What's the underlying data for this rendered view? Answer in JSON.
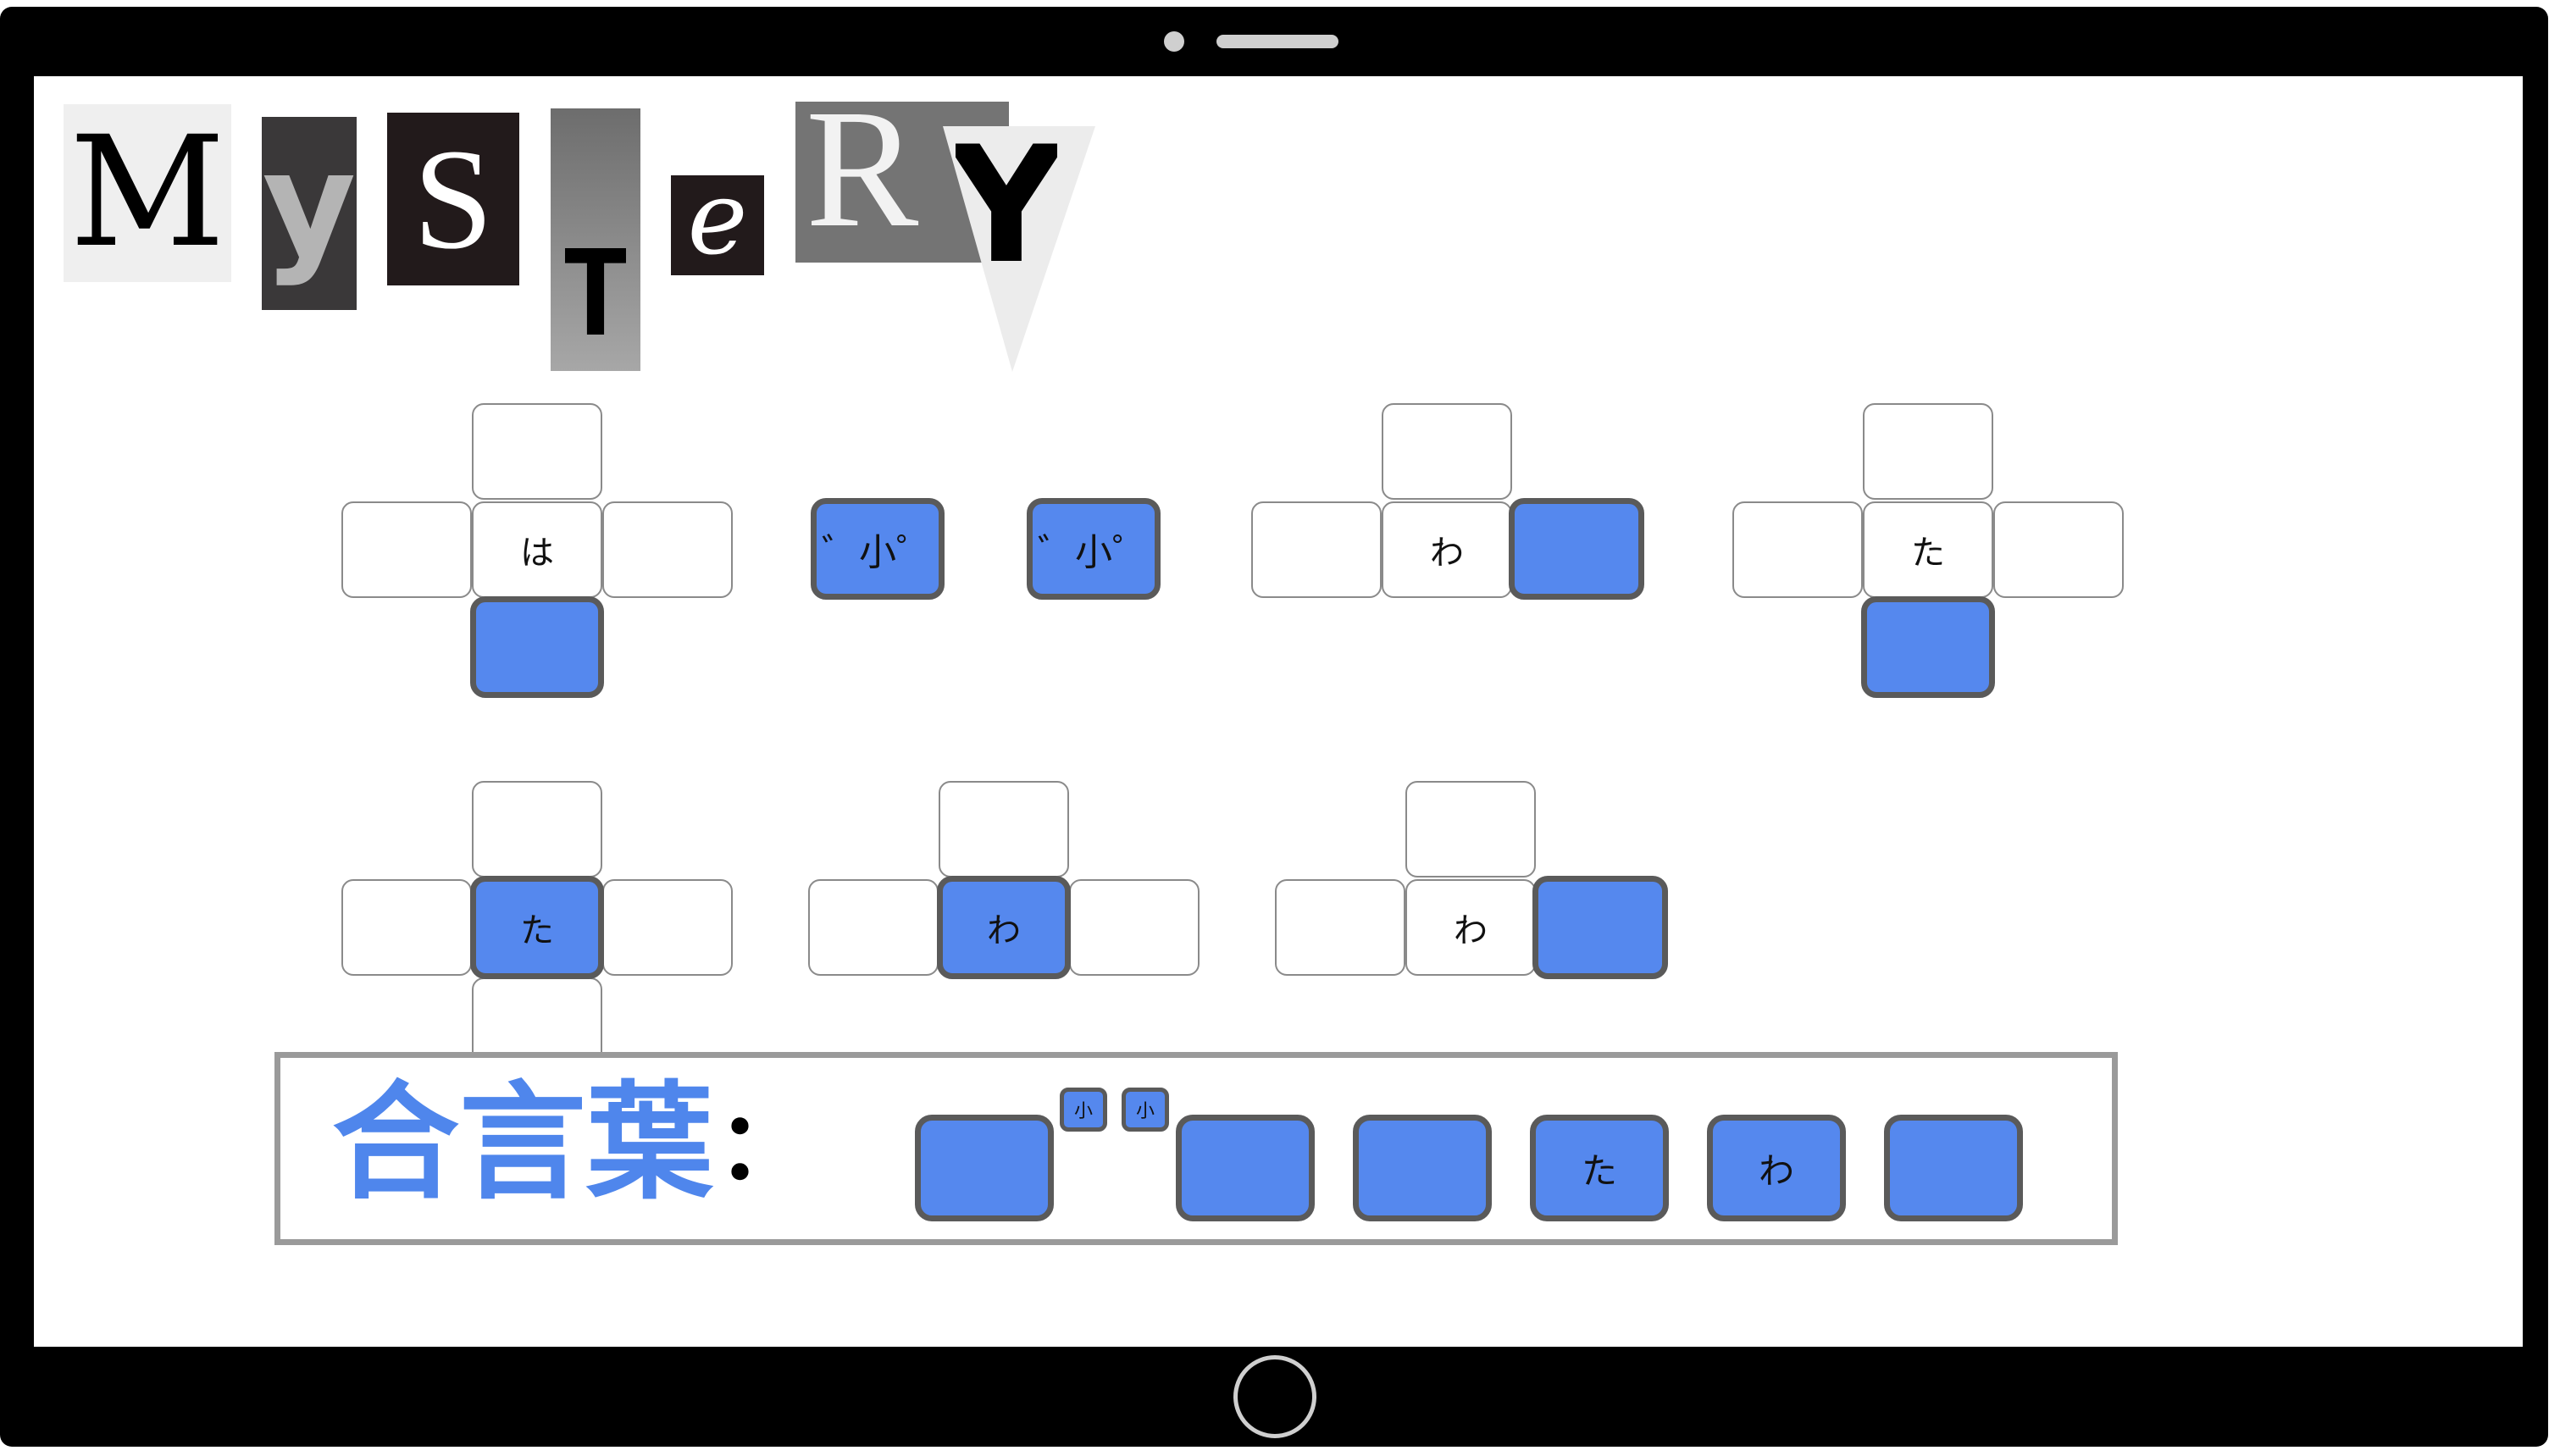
{
  "title": {
    "letters": [
      "M",
      "y",
      "S",
      "T",
      "e",
      "R",
      "Y"
    ]
  },
  "puzzles": {
    "cells": {
      "ha": "は",
      "small_mark": "゛小゜",
      "wa": "わ",
      "ta": "た"
    }
  },
  "answer": {
    "label": "合言葉",
    "colon": "：",
    "small_label": "小",
    "slots": [
      "",
      "",
      "",
      "た",
      "わ",
      ""
    ]
  },
  "colors": {
    "accent_blue": "#5588ee",
    "label_blue": "#4f86ec",
    "bezel": "#000000"
  }
}
